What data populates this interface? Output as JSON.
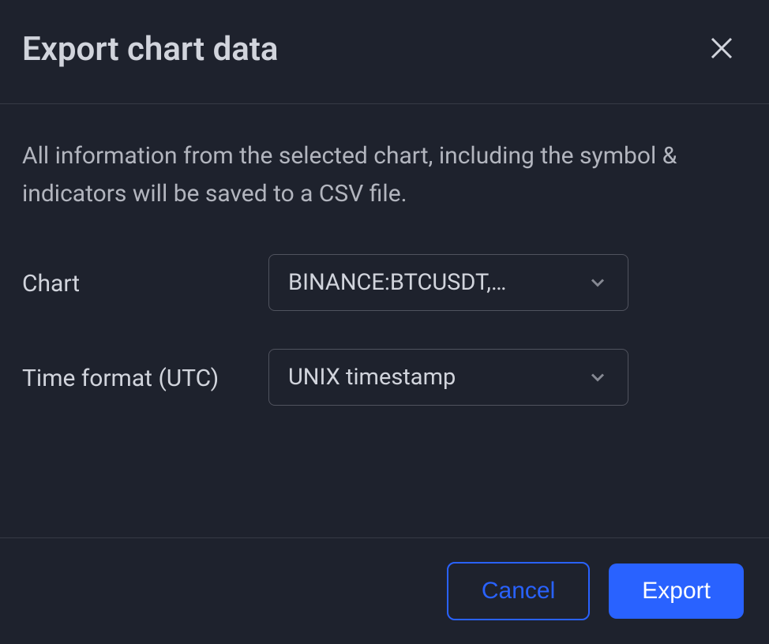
{
  "dialog": {
    "title": "Export chart data",
    "description": "All information from the selected chart, including the symbol & indicators will be saved to a CSV file.",
    "fields": {
      "chart": {
        "label": "Chart",
        "selected": "BINANCE:BTCUSDT,…"
      },
      "time_format": {
        "label": "Time format (UTC)",
        "selected": "UNIX timestamp"
      }
    },
    "buttons": {
      "cancel": "Cancel",
      "export": "Export"
    }
  }
}
